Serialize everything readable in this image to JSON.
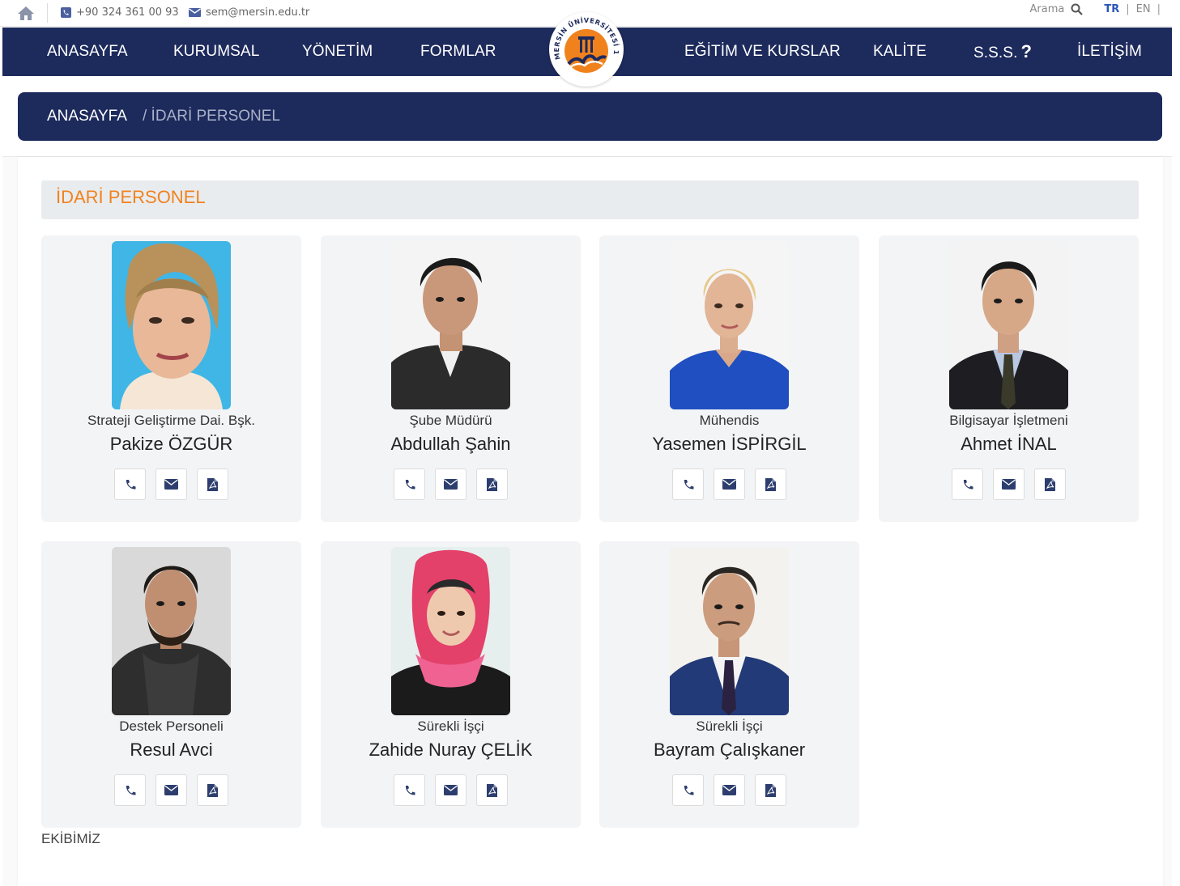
{
  "topbar": {
    "phone": "+90 324 361 00 93",
    "email": "sem@mersin.edu.tr",
    "search_label": "Arama",
    "lang_active": "TR",
    "lang_other": "EN",
    "pipe": "|"
  },
  "nav": {
    "items": [
      {
        "label": "ANASAYFA"
      },
      {
        "label": "KURUMSAL"
      },
      {
        "label": "YÖNETİM"
      },
      {
        "label": "FORMLAR"
      },
      {
        "label": "EĞİTİM VE KURSLAR"
      },
      {
        "label": "KALİTE"
      },
      {
        "label": "S.S.S."
      },
      {
        "label": "İLETİŞİM"
      }
    ],
    "faq_icon_glyph": "?"
  },
  "logo": {
    "ring_text": "MERSİN ÜNİVERSİTESİ 1992",
    "icon": "university-logo"
  },
  "breadcrumb": {
    "home": "ANASAYFA",
    "current": "/ İDARİ PERSONEL"
  },
  "section": {
    "title": "İDARİ PERSONEL"
  },
  "staff": [
    {
      "role": "Strateji Geliştirme Dai. Bşk.",
      "name": "Pakize ÖZGÜR"
    },
    {
      "role": "Şube Müdürü",
      "name": "Abdullah Şahin"
    },
    {
      "role": "Mühendis",
      "name": "Yasemen İSPİRGİL"
    },
    {
      "role": "Bilgisayar İşletmeni",
      "name": "Ahmet İNAL"
    },
    {
      "role": "Destek Personeli",
      "name": "Resul Avci"
    },
    {
      "role": "Sürekli İşçi",
      "name": "Zahide Nuray ÇELİK"
    },
    {
      "role": "Sürekli İşçi",
      "name": "Bayram Çalışkaner"
    }
  ],
  "card_icons": [
    "phone-icon",
    "envelope-icon",
    "pdf-file-icon"
  ],
  "footer": {
    "text": "EKİBİMİZ"
  },
  "colors": {
    "nav_bg": "#1d2a5c",
    "accent_orange": "#f0821e",
    "card_bg": "#f3f4f6",
    "lang_active": "#2a56b8"
  }
}
